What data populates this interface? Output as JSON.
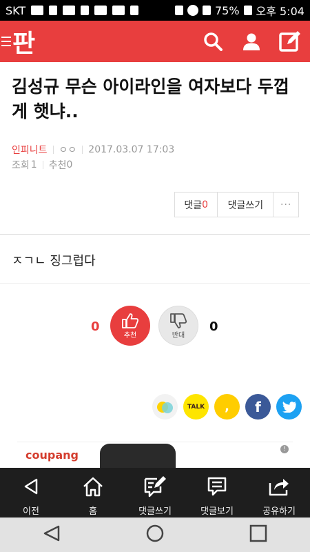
{
  "statusbar": {
    "carrier": "SKT",
    "battery": "75%",
    "time": "오후 5:04"
  },
  "header": {
    "logo": "판"
  },
  "article": {
    "title": "김성규 무슨 아이라인을 여자보다 두껍게 햇냐..",
    "author": "인피니트",
    "nickname": "ㅇㅇ",
    "datetime": "2017.03.07 17:03",
    "views_label": "조회",
    "views": "1",
    "recommend_label": "추천",
    "recommend": "0",
    "body": "ㅈㄱㄴ 징그럽다"
  },
  "comments": {
    "label": "댓글",
    "count": "0",
    "write_label": "댓글쓰기",
    "more": "···"
  },
  "votes": {
    "up_count": "0",
    "up_label": "추천",
    "down_label": "반대",
    "down_count": "0"
  },
  "share": {
    "kakaotalk": "TALK"
  },
  "ad": {
    "brand": "coupang",
    "info": "!"
  },
  "toolbar": {
    "items": [
      {
        "label": "이전"
      },
      {
        "label": "홈"
      },
      {
        "label": "댓글쓰기"
      },
      {
        "label": "댓글보기"
      },
      {
        "label": "공유하기"
      }
    ]
  },
  "colors": {
    "accent": "#e83e3e",
    "toolbar": "#1e1e1e"
  }
}
